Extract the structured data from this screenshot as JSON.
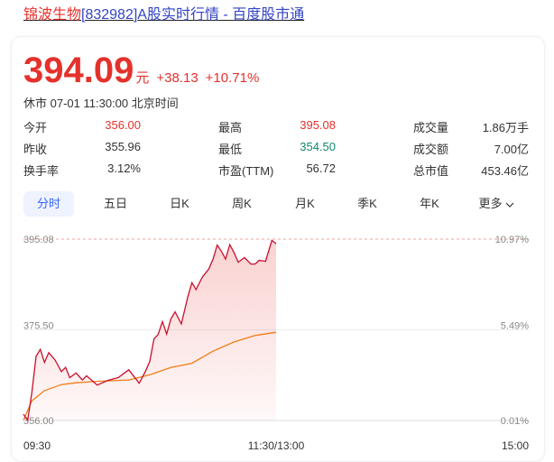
{
  "header": {
    "name": "锦波生物",
    "code": "[832982]",
    "suffix": "A股实时行情 - 百度股市通"
  },
  "quote": {
    "price": "394.09",
    "unit": "元",
    "change": "+38.13",
    "change_pct": "+10.71%",
    "status": "休市",
    "datetime": "07-01 11:30:00",
    "timezone": "北京时间"
  },
  "stats": [
    {
      "label": "今开",
      "value": "356.00",
      "color": "red"
    },
    {
      "label": "最高",
      "value": "395.08",
      "color": "red"
    },
    {
      "label": "成交量",
      "value": "1.86万手",
      "color": "dark"
    },
    {
      "label": "昨收",
      "value": "355.96",
      "color": "dark"
    },
    {
      "label": "最低",
      "value": "354.50",
      "color": "green"
    },
    {
      "label": "成交额",
      "value": "7.00亿",
      "color": "dark"
    },
    {
      "label": "换手率",
      "value": "3.12%",
      "color": "dark"
    },
    {
      "label": "市盈(TTM)",
      "value": "56.72",
      "color": "dark"
    },
    {
      "label": "总市值",
      "value": "453.46亿",
      "color": "dark"
    }
  ],
  "tabs": [
    "分时",
    "五日",
    "日K",
    "周K",
    "月K",
    "季K",
    "年K",
    "更多"
  ],
  "active_tab": "分时",
  "colors": {
    "up": "#e5312c",
    "down": "#14866d",
    "price_line": "#c8102e",
    "avg_line": "#f07d14",
    "accent": "#3366ff"
  },
  "chart_data": {
    "type": "line",
    "title": "",
    "xlabel": "",
    "ylabel": "",
    "ylim": [
      355.96,
      395.08
    ],
    "y_ticks_left": [
      "395.08",
      "375.50",
      "356.00"
    ],
    "y_ticks_right": [
      "10.97%",
      "5.49%",
      "0.01%"
    ],
    "x_ticks": [
      "09:30",
      "11:30/13:00",
      "15:00"
    ],
    "series": [
      {
        "role": "price",
        "x": [
          "09:30",
          "09:32",
          "09:34",
          "09:36",
          "09:38",
          "09:40",
          "09:42",
          "09:45",
          "09:48",
          "09:50",
          "09:52",
          "09:55",
          "09:58",
          "10:00",
          "10:05",
          "10:10",
          "10:15",
          "10:20",
          "10:25",
          "10:28",
          "10:30",
          "10:32",
          "10:34",
          "10:36",
          "10:38",
          "10:40",
          "10:42",
          "10:45",
          "10:48",
          "10:50",
          "10:52",
          "10:55",
          "10:58",
          "11:00",
          "11:02",
          "11:04",
          "11:06",
          "11:08",
          "11:10",
          "11:12",
          "11:15",
          "11:18",
          "11:20",
          "11:22",
          "11:25",
          "11:28",
          "11:30"
        ],
        "values": [
          357.3,
          356.0,
          362.0,
          369.8,
          371.3,
          368.5,
          370.6,
          369.0,
          366.5,
          367.4,
          365.2,
          366.2,
          364.7,
          365.6,
          363.6,
          364.6,
          365.2,
          366.9,
          364.0,
          366.6,
          368.7,
          373.6,
          374.5,
          377.3,
          374.6,
          377.8,
          379.4,
          376.8,
          382.5,
          385.7,
          384.2,
          386.9,
          388.6,
          390.7,
          393.8,
          392.5,
          390.8,
          393.9,
          392.2,
          390.1,
          391.1,
          389.7,
          389.7,
          390.5,
          390.3,
          394.8,
          394.09
        ]
      },
      {
        "role": "average",
        "x": [
          "09:30",
          "09:34",
          "09:40",
          "09:48",
          "09:55",
          "10:05",
          "10:20",
          "10:30",
          "10:40",
          "10:50",
          "11:00",
          "11:10",
          "11:20",
          "11:30"
        ],
        "values": [
          356.0,
          360.2,
          362.4,
          363.7,
          364.1,
          364.4,
          364.7,
          365.8,
          367.4,
          368.3,
          370.9,
          372.9,
          374.3,
          375.0
        ]
      }
    ]
  }
}
